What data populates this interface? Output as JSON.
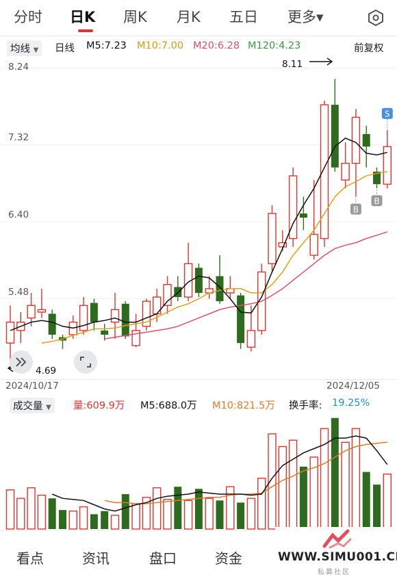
{
  "tabs": [
    "分时",
    "日K",
    "周K",
    "月K",
    "五日",
    "更多▾"
  ],
  "active_tab": "日K",
  "indicator_bar": {
    "ma_select": "均线",
    "period": "日线",
    "ma5": "M5:7.23",
    "ma10": "M10:7.00",
    "ma20": "M20:6.28",
    "ma120": "M120:4.23",
    "adjust": "前复权"
  },
  "price_axis": {
    "labels": [
      "8.24",
      "7.32",
      "6.40",
      "5.48"
    ]
  },
  "annotations": {
    "high": "8.11",
    "low": "4.69"
  },
  "date_axis": {
    "start": "2024/10/17",
    "end": "2024/12/05"
  },
  "markers": {
    "buy": "B",
    "sell": "S"
  },
  "volume_bar": {
    "select": "成交量",
    "vol": "量:609.9万",
    "m5": "M5:688.0万",
    "m10": "M10:821.5万",
    "turnover_label": "换手率:",
    "turnover_value": "19.25%"
  },
  "bottom_nav": [
    "看点",
    "资讯",
    "盘口",
    "资金"
  ],
  "watermark": {
    "text": "WWW.SIMU001.CN",
    "sub": "私募社区"
  },
  "colors": {
    "up": "#e0332e",
    "down": "#2f6b1e",
    "ma5": "#111111",
    "ma10": "#e0a016",
    "ma20": "#e0506a",
    "turnover": "#1e90d6"
  },
  "chart_data": {
    "type": "candlestick",
    "y_range": [
      4.6,
      8.3
    ],
    "candles": [
      {
        "o": 4.95,
        "c": 5.2,
        "h": 5.4,
        "l": 4.69
      },
      {
        "o": 5.1,
        "c": 5.2,
        "h": 5.32,
        "l": 4.95
      },
      {
        "o": 5.25,
        "c": 5.4,
        "h": 5.55,
        "l": 5.15
      },
      {
        "o": 5.32,
        "c": 5.35,
        "h": 5.6,
        "l": 5.25
      },
      {
        "o": 5.3,
        "c": 5.05,
        "h": 5.35,
        "l": 5.0
      },
      {
        "o": 5.02,
        "c": 4.98,
        "h": 5.05,
        "l": 4.88
      },
      {
        "o": 5.05,
        "c": 5.2,
        "h": 5.28,
        "l": 5.0
      },
      {
        "o": 5.1,
        "c": 5.4,
        "h": 5.5,
        "l": 5.05
      },
      {
        "o": 5.43,
        "c": 5.2,
        "h": 5.48,
        "l": 5.1
      },
      {
        "o": 5.1,
        "c": 5.05,
        "h": 5.18,
        "l": 4.98
      },
      {
        "o": 5.2,
        "c": 5.35,
        "h": 5.55,
        "l": 5.0
      },
      {
        "o": 5.42,
        "c": 5.03,
        "h": 5.45,
        "l": 5.0
      },
      {
        "o": 4.92,
        "c": 5.1,
        "h": 5.3,
        "l": 4.9
      },
      {
        "o": 5.15,
        "c": 5.45,
        "h": 5.48,
        "l": 5.1
      },
      {
        "o": 5.3,
        "c": 5.5,
        "h": 5.6,
        "l": 5.2
      },
      {
        "o": 5.4,
        "c": 5.65,
        "h": 5.75,
        "l": 5.3
      },
      {
        "o": 5.62,
        "c": 5.5,
        "h": 5.75,
        "l": 5.45
      },
      {
        "o": 5.5,
        "c": 5.9,
        "h": 6.15,
        "l": 5.45
      },
      {
        "o": 5.85,
        "c": 5.55,
        "h": 5.9,
        "l": 5.5
      },
      {
        "o": 5.55,
        "c": 5.6,
        "h": 5.75,
        "l": 5.48
      },
      {
        "o": 5.75,
        "c": 5.45,
        "h": 6.0,
        "l": 5.42
      },
      {
        "o": 5.55,
        "c": 5.6,
        "h": 5.75,
        "l": 5.48
      },
      {
        "o": 5.52,
        "c": 4.95,
        "h": 5.55,
        "l": 4.88
      },
      {
        "o": 4.9,
        "c": 5.1,
        "h": 5.4,
        "l": 4.85
      },
      {
        "o": 5.1,
        "c": 5.8,
        "h": 5.9,
        "l": 5.05
      },
      {
        "o": 5.9,
        "c": 6.5,
        "h": 6.6,
        "l": 5.8
      },
      {
        "o": 6.1,
        "c": 6.15,
        "h": 6.3,
        "l": 6.05
      },
      {
        "o": 6.2,
        "c": 6.95,
        "h": 7.05,
        "l": 6.1
      },
      {
        "o": 6.5,
        "c": 6.45,
        "h": 6.7,
        "l": 6.3
      },
      {
        "o": 6.0,
        "c": 6.25,
        "h": 6.9,
        "l": 5.95
      },
      {
        "o": 6.2,
        "c": 7.8,
        "h": 7.85,
        "l": 6.1
      },
      {
        "o": 7.8,
        "c": 7.05,
        "h": 8.11,
        "l": 7.0
      },
      {
        "o": 6.9,
        "c": 7.1,
        "h": 7.35,
        "l": 6.8
      },
      {
        "o": 7.1,
        "c": 7.65,
        "h": 7.75,
        "l": 6.7
      },
      {
        "o": 7.45,
        "c": 7.3,
        "h": 7.55,
        "l": 7.05
      },
      {
        "o": 7.0,
        "c": 6.85,
        "h": 7.05,
        "l": 6.8
      },
      {
        "o": 6.85,
        "c": 7.3,
        "h": 7.5,
        "l": 6.8
      }
    ],
    "ma5": [
      5.1,
      5.15,
      5.2,
      5.22,
      5.2,
      5.15,
      5.13,
      5.16,
      5.2,
      5.22,
      5.25,
      5.2,
      5.2,
      5.25,
      5.3,
      5.45,
      5.55,
      5.68,
      5.75,
      5.73,
      5.62,
      5.48,
      5.32,
      5.31,
      5.5,
      5.8,
      6.08,
      6.38,
      6.6,
      6.8,
      7.05,
      7.3,
      7.4,
      7.35,
      7.22,
      7.2,
      7.23
    ],
    "ma10": [
      null,
      null,
      null,
      4.95,
      4.97,
      5.0,
      5.04,
      5.08,
      5.12,
      5.12,
      5.13,
      5.16,
      5.18,
      5.2,
      5.26,
      5.32,
      5.38,
      5.42,
      5.48,
      5.55,
      5.58,
      5.6,
      5.6,
      5.55,
      5.55,
      5.65,
      5.8,
      6.0,
      6.15,
      6.3,
      6.5,
      6.7,
      6.82,
      6.88,
      6.95,
      6.98,
      7.0
    ],
    "ma20": [
      null,
      null,
      null,
      null,
      null,
      null,
      null,
      null,
      null,
      5.0,
      5.02,
      5.04,
      5.06,
      5.08,
      5.1,
      5.12,
      5.15,
      5.2,
      5.25,
      5.3,
      5.35,
      5.38,
      5.4,
      5.42,
      5.45,
      5.52,
      5.6,
      5.7,
      5.8,
      5.9,
      6.0,
      6.08,
      6.12,
      6.15,
      6.2,
      6.24,
      6.28
    ],
    "buy_points": [
      33,
      35
    ],
    "sell_points": [
      36
    ],
    "volume": {
      "y_range": [
        0,
        1100
      ],
      "bars": [
        370,
        290,
        390,
        320,
        290,
        180,
        170,
        210,
        140,
        170,
        130,
        330,
        240,
        300,
        390,
        280,
        400,
        270,
        380,
        290,
        270,
        400,
        250,
        290,
        480,
        900,
        780,
        840,
        590,
        680,
        950,
        1050,
        820,
        950,
        540,
        420,
        520
      ],
      "ma5": [
        null,
        null,
        null,
        null,
        330,
        290,
        280,
        270,
        230,
        190,
        170,
        200,
        230,
        250,
        290,
        310,
        320,
        330,
        350,
        340,
        330,
        330,
        330,
        320,
        330,
        480,
        600,
        660,
        720,
        760,
        800,
        860,
        860,
        880,
        860,
        740,
        609.9
      ],
      "ma10": [
        null,
        null,
        null,
        null,
        null,
        null,
        null,
        null,
        null,
        270,
        250,
        250,
        240,
        240,
        250,
        260,
        270,
        280,
        290,
        300,
        300,
        320,
        330,
        330,
        340,
        400,
        460,
        500,
        550,
        580,
        620,
        680,
        740,
        780,
        800,
        810,
        821.5
      ]
    }
  }
}
